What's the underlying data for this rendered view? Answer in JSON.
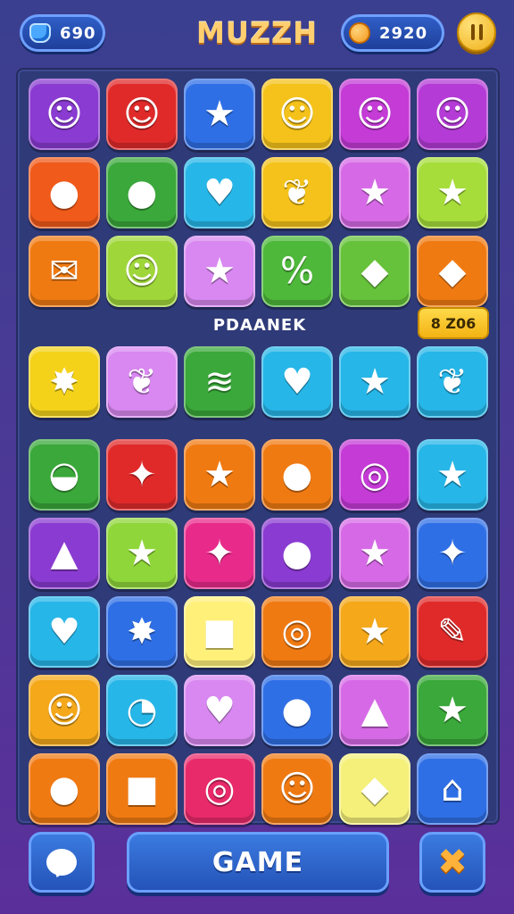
{
  "header": {
    "gems": "690",
    "title": "MUZZH",
    "coins": "2920"
  },
  "board": {
    "label": "PDAANEK",
    "score": "8 Z06",
    "rows": [
      [
        {
          "icon": "ghost-face-icon",
          "glyph": "☺",
          "color": "#8a3bd1"
        },
        {
          "icon": "cat-face-icon",
          "glyph": "☺",
          "color": "#e02a2a"
        },
        {
          "icon": "star-icon",
          "glyph": "★",
          "color": "#2f6fe6"
        },
        {
          "icon": "cat-face-icon",
          "glyph": "☺",
          "color": "#f4c21a"
        },
        {
          "icon": "bear-face-icon",
          "glyph": "☺",
          "color": "#c43bd6"
        },
        {
          "icon": "husky-face-icon",
          "glyph": "☺",
          "color": "#b43bd6"
        }
      ],
      [
        {
          "icon": "apple-icon",
          "glyph": "●",
          "color": "#f05a1a"
        },
        {
          "icon": "cookie-icon",
          "glyph": "●",
          "color": "#3aa83a"
        },
        {
          "icon": "heart-icon",
          "glyph": "♥",
          "color": "#27b6e8"
        },
        {
          "icon": "leaf-icon",
          "glyph": "❦",
          "color": "#f4c21a"
        },
        {
          "icon": "star-icon",
          "glyph": "★",
          "color": "#d66ae6"
        },
        {
          "icon": "star-icon",
          "glyph": "★",
          "color": "#a6dd3a"
        }
      ],
      [
        {
          "icon": "chat-bubble-icon",
          "glyph": "✉",
          "color": "#f07a12"
        },
        {
          "icon": "cat-face-icon",
          "glyph": "☺",
          "color": "#9fd63a"
        },
        {
          "icon": "star-icon",
          "glyph": "★",
          "color": "#d888f0"
        },
        {
          "icon": "percent-icon",
          "glyph": "%",
          "color": "#4eb83a"
        },
        {
          "icon": "puzzle-icon",
          "glyph": "◆",
          "color": "#66c23a"
        },
        {
          "icon": "book-icon",
          "glyph": "◆",
          "color": "#f07a12"
        }
      ],
      [
        {
          "icon": "star-icon",
          "glyph": "✸",
          "color": "#f4d21a"
        },
        {
          "icon": "leaf-icon",
          "glyph": "❦",
          "color": "#d888f0"
        },
        {
          "icon": "flag-icon",
          "glyph": "≋",
          "color": "#3aa83a"
        },
        {
          "icon": "heart-icon",
          "glyph": "♥",
          "color": "#27b6e8"
        },
        {
          "icon": "star-icon",
          "glyph": "★",
          "color": "#27b6e8"
        },
        {
          "icon": "leaf-icon",
          "glyph": "❦",
          "color": "#27b6e8"
        }
      ],
      [
        {
          "icon": "bowl-icon",
          "glyph": "◒",
          "color": "#3aa83a"
        },
        {
          "icon": "feather-icon",
          "glyph": "✦",
          "color": "#e02a2a"
        },
        {
          "icon": "star-icon",
          "glyph": "★",
          "color": "#f07a12"
        },
        {
          "icon": "balloon-icon",
          "glyph": "●",
          "color": "#f07a12"
        },
        {
          "icon": "lollipop-icon",
          "glyph": "◎",
          "color": "#c43bd6"
        },
        {
          "icon": "star-icon",
          "glyph": "★",
          "color": "#27b6e8"
        }
      ],
      [
        {
          "icon": "cupcake-icon",
          "glyph": "▲",
          "color": "#8a3bd1"
        },
        {
          "icon": "star-icon",
          "glyph": "★",
          "color": "#8fd63a"
        },
        {
          "icon": "dragon-icon",
          "glyph": "✦",
          "color": "#e82a8a"
        },
        {
          "icon": "map-pin-icon",
          "glyph": "●",
          "color": "#8a3bd1"
        },
        {
          "icon": "star-icon",
          "glyph": "★",
          "color": "#d66ae6"
        },
        {
          "icon": "diamond-star-icon",
          "glyph": "✦",
          "color": "#2f6fe6"
        }
      ],
      [
        {
          "icon": "chili-icon",
          "glyph": "♥",
          "color": "#27b6e8"
        },
        {
          "icon": "splat-icon",
          "glyph": "✸",
          "color": "#2f6fe6"
        },
        {
          "icon": "note-icon",
          "glyph": "■",
          "color": "#fff07a"
        },
        {
          "icon": "wand-ball-icon",
          "glyph": "◎",
          "color": "#f07a12"
        },
        {
          "icon": "star-icon",
          "glyph": "★",
          "color": "#f4a81a"
        },
        {
          "icon": "pencil-icon",
          "glyph": "✎",
          "color": "#e02a2a"
        }
      ],
      [
        {
          "icon": "cat-face-icon",
          "glyph": "☺",
          "color": "#f4a81a"
        },
        {
          "icon": "swirl-icon",
          "glyph": "◔",
          "color": "#27b6e8"
        },
        {
          "icon": "heart-icon",
          "glyph": "♥",
          "color": "#d888f0"
        },
        {
          "icon": "carrot-icon",
          "glyph": "●",
          "color": "#2f6fe6"
        },
        {
          "icon": "muffin-icon",
          "glyph": "▲",
          "color": "#d66ae6"
        },
        {
          "icon": "star-icon",
          "glyph": "★",
          "color": "#3aa83a"
        }
      ],
      [
        {
          "icon": "fruit-icon",
          "glyph": "●",
          "color": "#f07a12"
        },
        {
          "icon": "photo-icon",
          "glyph": "■",
          "color": "#f07a12"
        },
        {
          "icon": "ball-icon",
          "glyph": "◎",
          "color": "#e82a6a"
        },
        {
          "icon": "burger-icon",
          "glyph": "☺",
          "color": "#f07a12"
        },
        {
          "icon": "ticket-icon",
          "glyph": "◆",
          "color": "#f4f07a"
        },
        {
          "icon": "house-icon",
          "glyph": "⌂",
          "color": "#2f6fe6"
        }
      ]
    ]
  },
  "footer": {
    "game_label": "GAME"
  }
}
